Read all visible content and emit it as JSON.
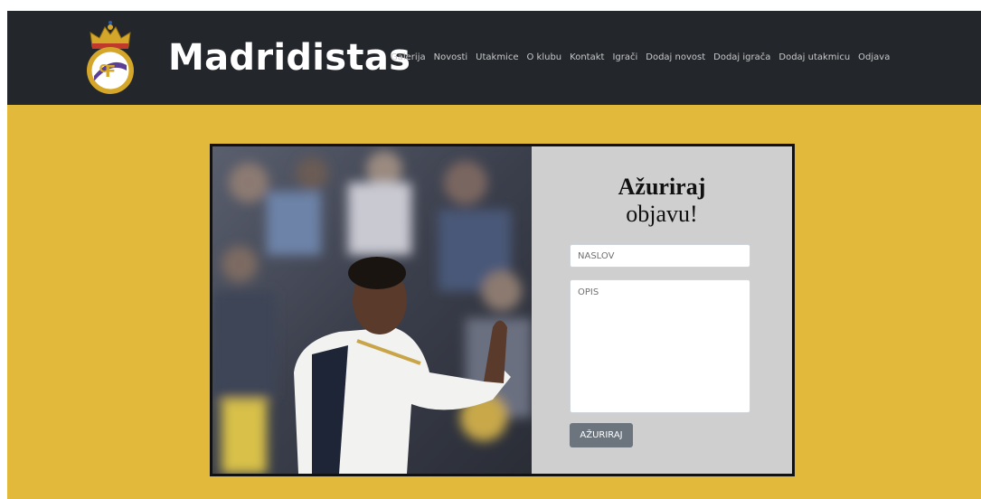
{
  "brand": {
    "title": "Madridistas"
  },
  "nav": {
    "items": [
      {
        "label": "Galerija"
      },
      {
        "label": "Novosti"
      },
      {
        "label": "Utakmice"
      },
      {
        "label": "O klubu"
      },
      {
        "label": "Kontakt"
      },
      {
        "label": "Igrači"
      },
      {
        "label": "Dodaj novost"
      },
      {
        "label": "Dodaj igrača"
      },
      {
        "label": "Dodaj utakmicu"
      },
      {
        "label": "Odjava"
      }
    ]
  },
  "form": {
    "title_line1": "Ažuriraj",
    "title_line2": "objavu!",
    "naslov_placeholder": "NASLOV",
    "opis_placeholder": "OPIS",
    "submit_label": "AŽURIRAJ"
  },
  "colors": {
    "navbar": "#23262b",
    "page_background": "#e2b93b",
    "form_panel": "#cfcfcf",
    "button": "#6c757d"
  },
  "icons": {
    "logo": "real-madrid-crest-icon"
  }
}
